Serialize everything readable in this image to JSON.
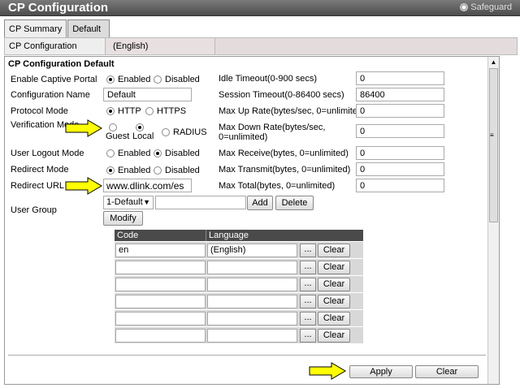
{
  "window": {
    "title": "CP Configuration",
    "badge": "Safeguard"
  },
  "tabs": [
    {
      "label": "CP Summary"
    },
    {
      "label": "Default"
    }
  ],
  "subtab": {
    "label": "CP Configuration",
    "language": "(English)"
  },
  "section": {
    "title": "CP Configuration Default"
  },
  "left": {
    "captive_portal": {
      "label": "Enable Captive Portal",
      "opt1": "Enabled",
      "opt2": "Disabled"
    },
    "config_name": {
      "label": "Configuration Name",
      "value": "Default"
    },
    "protocol": {
      "label": "Protocol Mode",
      "opt1": "HTTP",
      "opt2": "HTTPS"
    },
    "verification": {
      "label": "Verification Mode",
      "opt1": "Guest",
      "opt2": "Local",
      "opt3": "RADIUS"
    },
    "logout": {
      "label": "User Logout Mode",
      "opt1": "Enabled",
      "opt2": "Disabled"
    },
    "redirect_mode": {
      "label": "Redirect Mode",
      "opt1": "Enabled",
      "opt2": "Disabled"
    },
    "redirect_url": {
      "label": "Redirect URL",
      "value": "www.dlink.com/es"
    },
    "user_group": {
      "label": "User Group",
      "selected": "1-Default",
      "add": "Add",
      "delete": "Delete",
      "modify": "Modify"
    }
  },
  "right": {
    "idle": {
      "label": "Idle Timeout(0-900 secs)",
      "value": "0"
    },
    "session": {
      "label": "Session Timeout(0-86400 secs)",
      "value": "86400"
    },
    "max_up": {
      "label": "Max Up Rate(bytes/sec, 0=unlimited)",
      "value": "0"
    },
    "max_down": {
      "label1": "Max Down Rate(bytes/sec,",
      "label2": "0=unlimited)",
      "value": "0"
    },
    "max_recv": {
      "label": "Max Receive(bytes, 0=unlimited)",
      "value": "0"
    },
    "max_tx": {
      "label": "Max Transmit(bytes, 0=unlimited)",
      "value": "0"
    },
    "max_total": {
      "label": "Max Total(bytes, 0=unlimited)",
      "value": "0"
    }
  },
  "code_table": {
    "headers": {
      "code": "Code",
      "language": "Language"
    },
    "rows": [
      {
        "code": "en",
        "language": "(English)"
      },
      {
        "code": "",
        "language": ""
      },
      {
        "code": "",
        "language": ""
      },
      {
        "code": "",
        "language": ""
      },
      {
        "code": "",
        "language": ""
      },
      {
        "code": "",
        "language": ""
      }
    ],
    "browse_label": "...",
    "clear_label": "Clear"
  },
  "footer": {
    "apply": "Apply",
    "clear": "Clear"
  },
  "colors": {
    "arrow": "#ffff00",
    "titlebar": "#5a5a5a",
    "table_header": "#4a4a4a"
  }
}
